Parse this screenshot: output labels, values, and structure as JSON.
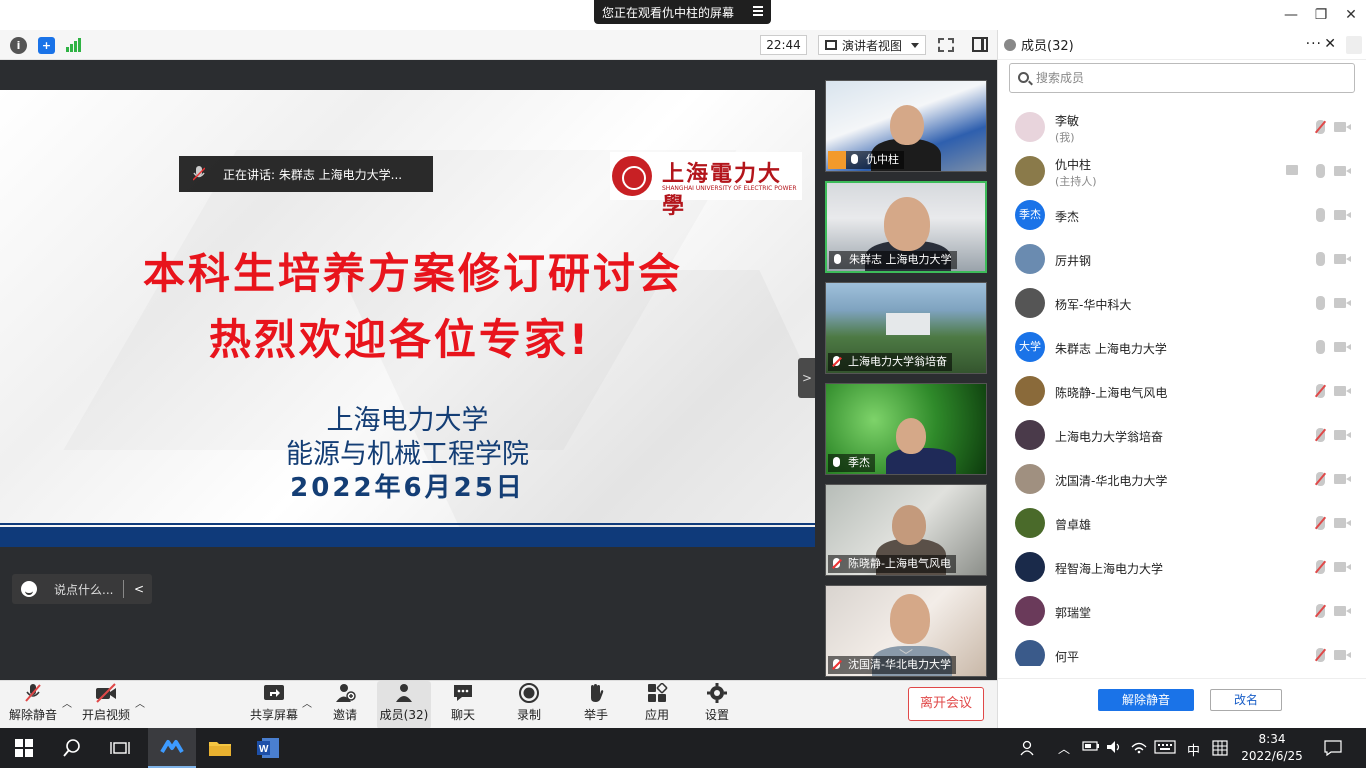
{
  "titlebar": {
    "share_notice": "您正在观看仇中柱的屏幕",
    "min": "—",
    "restore": "❐",
    "close": "✕"
  },
  "toolbar": {
    "time": "22:44",
    "view_label": "演讲者视图"
  },
  "slide": {
    "speaking_label": "正在讲话: 朱群志 上海电力大学...",
    "logo_cn": "上海電力大學",
    "logo_en": "SHANGHAI UNIVERSITY OF ELECTRIC POWER",
    "title_line1": "本科生培养方案修订研讨会",
    "title_line2": "热烈欢迎各位专家!",
    "org": "上海电力大学",
    "school": "能源与机械工程学院",
    "date": "2022年6月25日"
  },
  "chat": {
    "placeholder": "说点什么..."
  },
  "video_tiles": [
    {
      "name": "仇中柱"
    },
    {
      "name": "朱群志 上海电力大学"
    },
    {
      "name": "上海电力大学翁培奋"
    },
    {
      "name": "季杰"
    },
    {
      "name": "陈晓静-上海电气风电"
    },
    {
      "name": "沈国清-华北电力大学"
    }
  ],
  "bottombar": {
    "unmute": "解除静音",
    "start_video": "开启视频",
    "share_screen": "共享屏幕",
    "invite": "邀请",
    "members": "成员(32)",
    "chat": "聊天",
    "record": "录制",
    "raise_hand": "举手",
    "apps": "应用",
    "settings": "设置",
    "leave": "离开会议"
  },
  "panel": {
    "title": "成员(32)",
    "search_placeholder": "搜索成员",
    "members": [
      {
        "name": "李敏",
        "role": "(我)",
        "avatar_text": "",
        "color": "#e8d4dc"
      },
      {
        "name": "仇中柱",
        "role": "(主持人)",
        "avatar_text": "",
        "color": "#8a7a4a"
      },
      {
        "name": "季杰",
        "role": "",
        "avatar_text": "季杰",
        "color": "#1a73e8"
      },
      {
        "name": "厉井钢",
        "role": "",
        "avatar_text": "",
        "color": "#6a8bb0"
      },
      {
        "name": "杨军-华中科大",
        "role": "",
        "avatar_text": "",
        "color": "#555555"
      },
      {
        "name": "朱群志 上海电力大学",
        "role": "",
        "avatar_text": "大学",
        "color": "#1a73e8"
      },
      {
        "name": "陈晓静-上海电气风电",
        "role": "",
        "avatar_text": "",
        "color": "#8a6a3a"
      },
      {
        "name": "上海电力大学翁培奋",
        "role": "",
        "avatar_text": "",
        "color": "#4a3a4a"
      },
      {
        "name": "沈国清-华北电力大学",
        "role": "",
        "avatar_text": "",
        "color": "#a09080"
      },
      {
        "name": "曾卓雄",
        "role": "",
        "avatar_text": "",
        "color": "#4a6a2a"
      },
      {
        "name": "程智海上海电力大学",
        "role": "",
        "avatar_text": "",
        "color": "#1a2a4a"
      },
      {
        "name": "郭瑞堂",
        "role": "",
        "avatar_text": "",
        "color": "#6a3a5a"
      },
      {
        "name": "何平",
        "role": "",
        "avatar_text": "",
        "color": "#3a5a8a"
      }
    ],
    "unmute_btn": "解除静音",
    "rename_btn": "改名"
  },
  "taskbar": {
    "ime": "中",
    "time": "8:34",
    "date": "2022/6/25"
  },
  "colors": {
    "title_red": "#e8141c",
    "navy": "#143e75",
    "accent_blue": "#1a73e8",
    "leave_red": "#e04848"
  }
}
